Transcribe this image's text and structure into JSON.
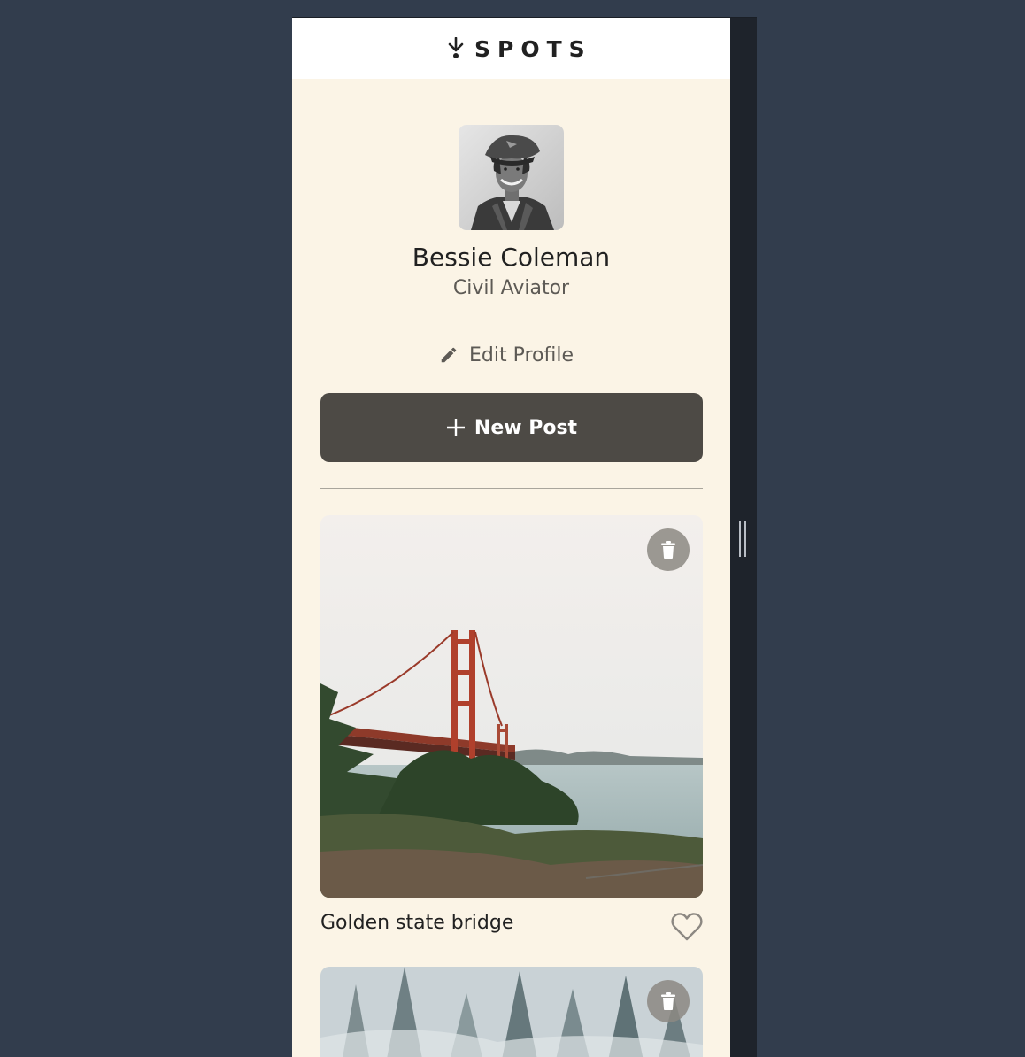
{
  "header": {
    "logo_text": "SPOTS"
  },
  "profile": {
    "name": "Bessie Coleman",
    "description": "Civil Aviator",
    "edit_label": "Edit Profile",
    "new_post_label": "New Post"
  },
  "cards": [
    {
      "title": "Golden state bridge"
    },
    {
      "title": ""
    }
  ],
  "colors": {
    "page_background": "#323d4d",
    "content_background": "#fbf4e6",
    "button_dark": "#4d4a45",
    "text_primary": "#212121",
    "text_secondary": "#5d5a55"
  },
  "icons": {
    "logo": "pin-icon",
    "edit": "pencil-icon",
    "new_post": "plus-icon",
    "delete": "trash-icon",
    "like": "heart-icon"
  }
}
